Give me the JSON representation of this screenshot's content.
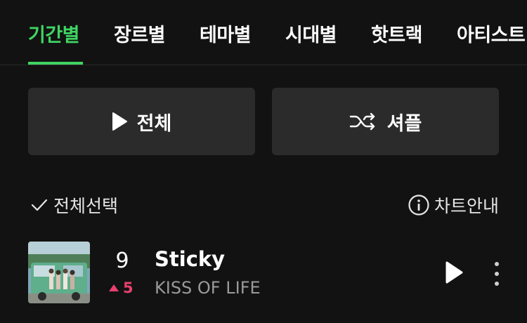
{
  "tabs": [
    {
      "label": "기간별",
      "active": true
    },
    {
      "label": "장르별",
      "active": false
    },
    {
      "label": "테마별",
      "active": false
    },
    {
      "label": "시대별",
      "active": false
    },
    {
      "label": "핫트랙",
      "active": false
    },
    {
      "label": "아티스트",
      "active": false
    }
  ],
  "actions": {
    "play_all_label": "전체",
    "shuffle_label": "셔플"
  },
  "toolbar": {
    "select_all_label": "전체선택",
    "chart_info_label": "차트안내"
  },
  "tracks": [
    {
      "rank": "9",
      "change": "5",
      "change_direction": "up",
      "title": "Sticky",
      "artist": "KISS OF LIFE"
    }
  ],
  "colors": {
    "accent": "#3fd563",
    "rank_up": "#e9406f",
    "background": "#121212",
    "button_bg": "#2b2b2b"
  }
}
